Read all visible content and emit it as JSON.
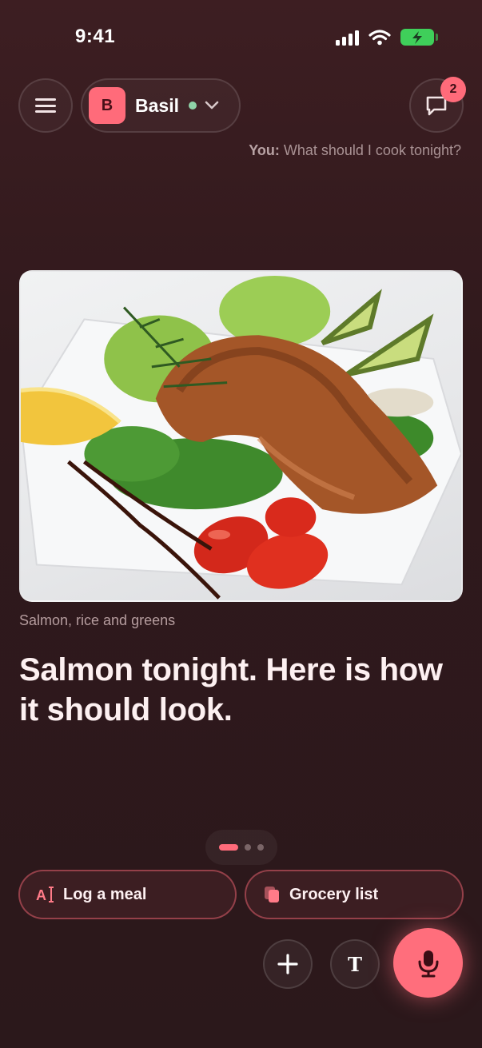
{
  "status_bar": {
    "time": "9:41"
  },
  "header": {
    "agent": {
      "avatar_letter": "B",
      "name": "Basil"
    },
    "notifications_count": "2"
  },
  "last_prompt": {
    "speaker": "You:",
    "text": "What should I cook tonight?"
  },
  "card": {
    "image_alt": "Grilled salmon steak on greens with tomatoes, lemon and avocado",
    "caption": "Salmon, rice and greens",
    "headline": "Salmon tonight. Here is how it should look."
  },
  "pager": {
    "pages": 3,
    "active_index": 0
  },
  "actions": {
    "log_meal": "Log a meal",
    "grocery_list": "Grocery list",
    "log_icon_text": "A"
  },
  "input": {
    "text_mode_glyph": "T"
  },
  "colors": {
    "accent": "#ff6b7a",
    "online": "#8fd3a8",
    "background": "#30191c"
  },
  "icons": [
    "menu-icon",
    "chevron-down-icon",
    "chat-bubble-icon",
    "text-cursor-icon",
    "copy-icon",
    "plus-icon",
    "text-icon",
    "microphone-icon"
  ]
}
